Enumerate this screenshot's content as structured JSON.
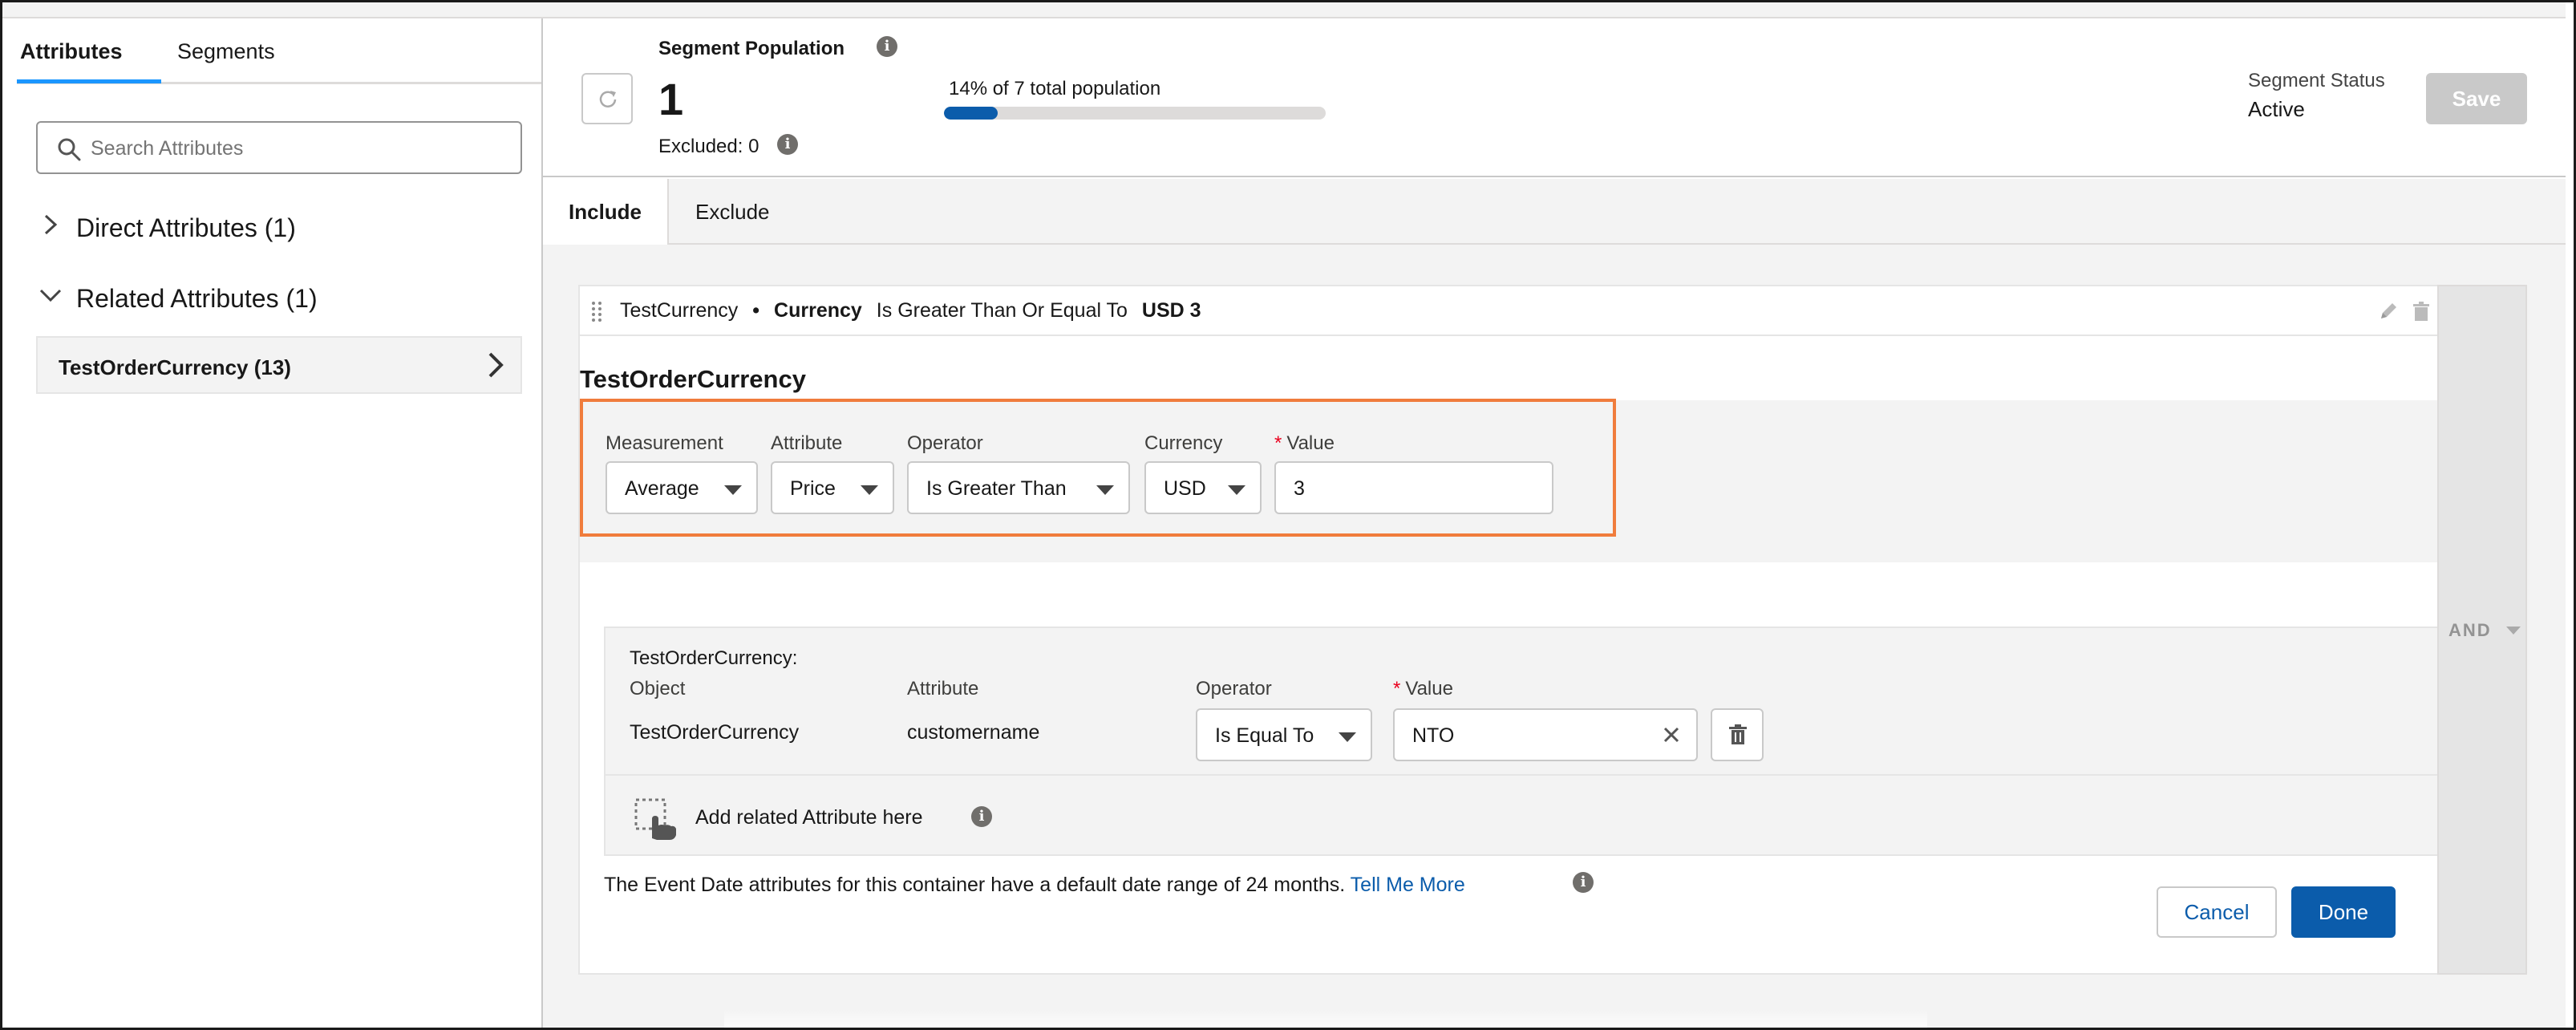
{
  "left_panel": {
    "tabs": [
      {
        "label": "Attributes",
        "active": true
      },
      {
        "label": "Segments",
        "active": false
      }
    ],
    "search": {
      "placeholder": "Search Attributes",
      "value": ""
    },
    "groups": [
      {
        "label": "Direct Attributes (1)",
        "expanded": false
      },
      {
        "label": "Related Attributes (1)",
        "expanded": true
      }
    ],
    "items": [
      {
        "label": "TestOrderCurrency (13)"
      }
    ]
  },
  "header": {
    "population_title": "Segment Population",
    "population_value": "1",
    "excluded": "Excluded: 0",
    "percent_text": "14% of 7 total population",
    "progress_fraction": 0.14,
    "status_label": "Segment Status",
    "status_value": "Active",
    "save_label": "Save"
  },
  "main_tabs": [
    {
      "label": "Include",
      "active": true
    },
    {
      "label": "Exclude",
      "active": false
    }
  ],
  "criteria_summary": {
    "object": "TestCurrency",
    "bullet": "•",
    "field": "Currency",
    "operator": "Is Greater Than Or Equal To",
    "value": "USD 3"
  },
  "container": {
    "title": "TestOrderCurrency",
    "fields": {
      "measurement": {
        "label": "Measurement",
        "value": "Average"
      },
      "attribute": {
        "label": "Attribute",
        "value": "Price"
      },
      "operator": {
        "label": "Operator",
        "value": "Is Greater Than"
      },
      "currency": {
        "label": "Currency",
        "value": "USD"
      },
      "value": {
        "label": "Value",
        "value": "3",
        "required": true
      }
    },
    "highlight_color": "#f07c3c",
    "related": {
      "heading": "TestOrderCurrency:",
      "object_label": "Object",
      "object_value": "TestOrderCurrency",
      "attribute_label": "Attribute",
      "attribute_value": "customername",
      "operator_label": "Operator",
      "operator_value": "Is Equal To",
      "value_label": "Value",
      "value_value": "NTO",
      "add_label": "Add related Attribute here"
    },
    "note": "The Event Date attributes for this container have a default date range of 24 months.",
    "note_link": "Tell Me More",
    "cancel_label": "Cancel",
    "done_label": "Done"
  },
  "logic": {
    "label": "AND"
  },
  "colors": {
    "brand": "#0b5cab",
    "tab_underline": "#1b96ff",
    "progress": "#0b5cab"
  }
}
